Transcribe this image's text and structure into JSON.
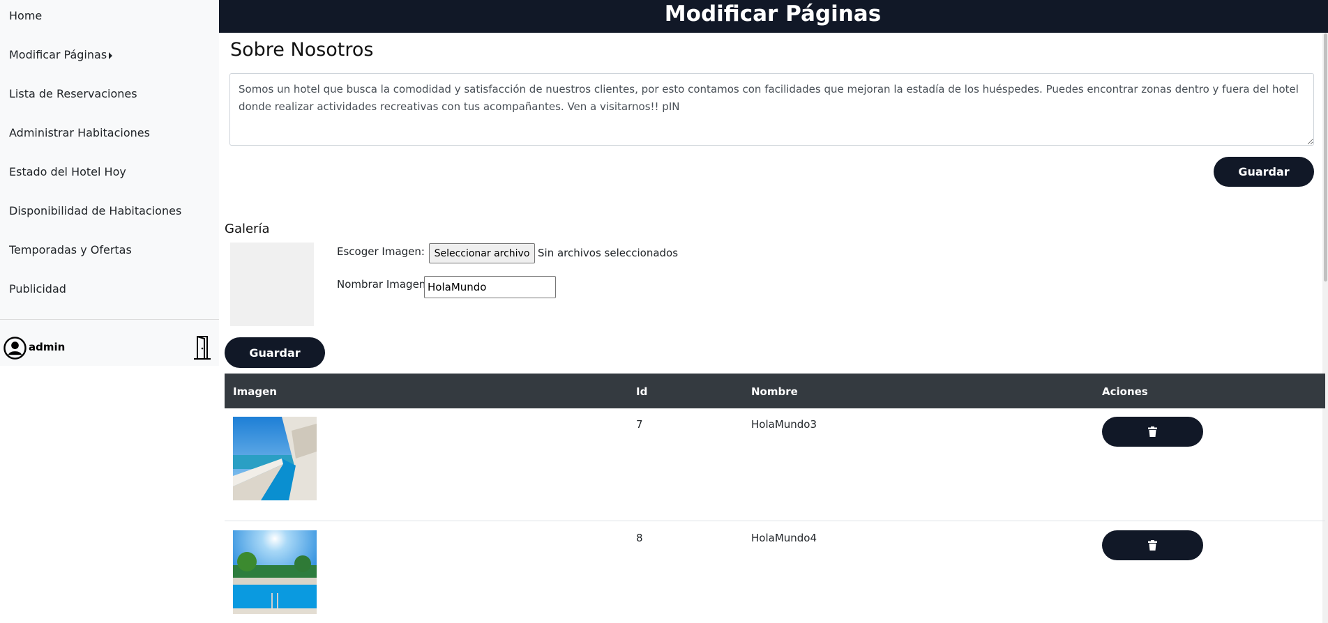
{
  "sidebar": {
    "items": [
      {
        "label": "Home"
      },
      {
        "label": "Modificar Páginas"
      },
      {
        "label": "Lista de Reservaciones"
      },
      {
        "label": "Administrar Habitaciones"
      },
      {
        "label": "Estado del Hotel Hoy"
      },
      {
        "label": "Disponibilidad de Habitaciones"
      },
      {
        "label": "Temporadas y Ofertas"
      },
      {
        "label": "Publicidad"
      }
    ],
    "user": {
      "name": "admin",
      "avatar_icon": "user-circle-icon",
      "logout_icon": "door-icon"
    }
  },
  "header": {
    "title": "Modificar Páginas"
  },
  "about": {
    "title": "Sobre Nosotros",
    "text": "Somos un hotel que busca la comodidad y satisfacción de nuestros clientes, por esto contamos con facilidades que mejoran la estadía de los huéspedes. Puedes encontrar zonas dentro y fuera del hotel donde realizar actividades recreativas con tus acompañantes. Ven a visitarnos!! pIN",
    "save_label": "Guardar"
  },
  "gallery": {
    "title": "Galería",
    "choose_label": "Escoger Imagen:",
    "file_button": "Seleccionar archivo",
    "file_status": "Sin archivos seleccionados",
    "name_label": "Nombrar Imagen:",
    "name_value": "HolaMundo",
    "save_label": "Guardar"
  },
  "table": {
    "headers": {
      "image": "Imagen",
      "id": "Id",
      "name": "Nombre",
      "actions": "Aciones"
    },
    "rows": [
      {
        "id": "7",
        "name": "HolaMundo3",
        "action_icon": "trash-icon"
      },
      {
        "id": "8",
        "name": "HolaMundo4",
        "action_icon": "trash-icon"
      }
    ]
  },
  "colors": {
    "dark": "#111827",
    "table_head": "#343a40",
    "sidebar_bg": "#f8f9fa"
  }
}
